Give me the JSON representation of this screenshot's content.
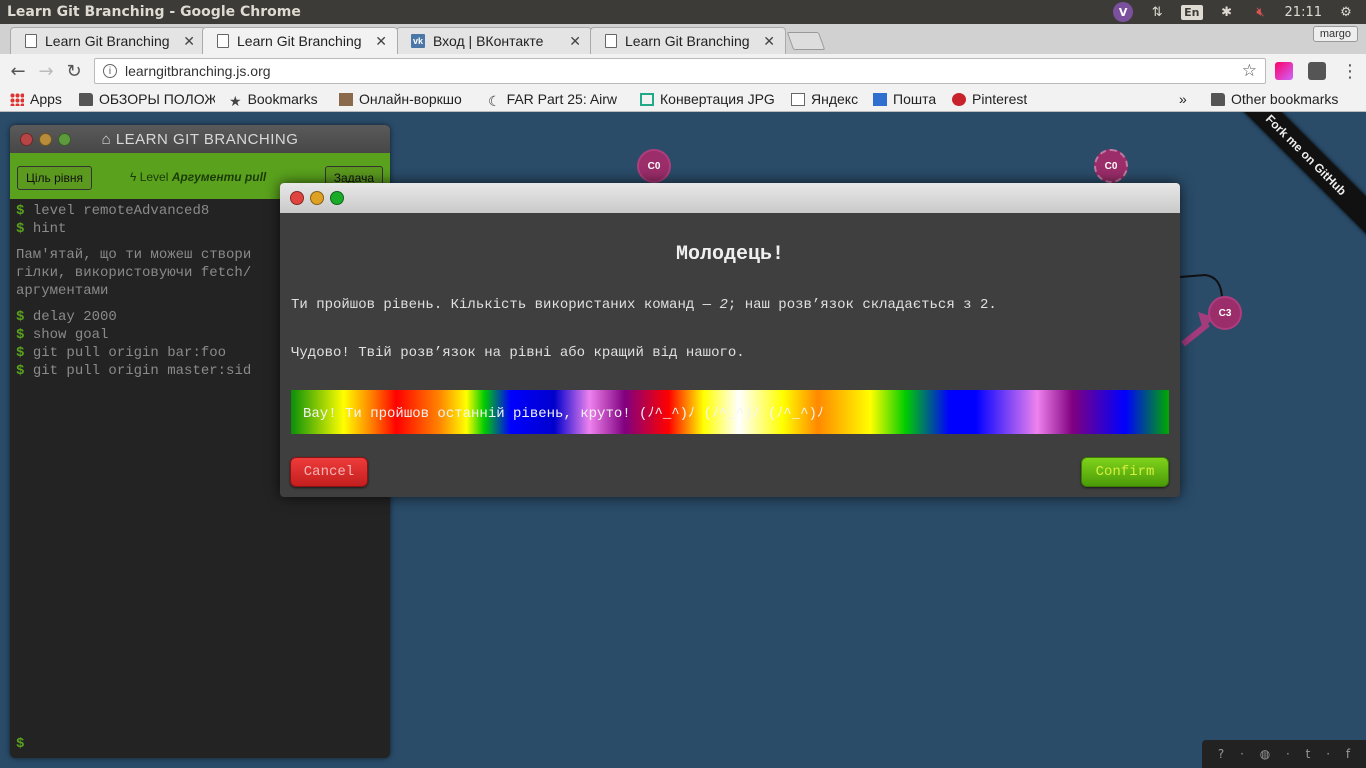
{
  "os_panel": {
    "window_title": "Learn Git Branching - Google Chrome",
    "keyboard_layout": "En",
    "clock": "21:11",
    "viber_letter": "V"
  },
  "tabs": [
    {
      "label": "Learn Git Branching",
      "active": false
    },
    {
      "label": "Learn Git Branching",
      "active": true
    },
    {
      "label": "Вход | ВКонтакте",
      "active": false
    },
    {
      "label": "Learn Git Branching",
      "active": false
    }
  ],
  "profile_name": "margo",
  "omnibox": {
    "url": "learngitbranching.js.org"
  },
  "bookmarks": [
    {
      "label": "Apps"
    },
    {
      "label": "ОБЗОРЫ ПОЛОЖ"
    },
    {
      "label": "Bookmarks"
    },
    {
      "label": "Онлайн-воркшо"
    },
    {
      "label": "FAR Part 25: Airw"
    },
    {
      "label": "Конвертация JPG"
    },
    {
      "label": "Яндекс"
    },
    {
      "label": "Пошта"
    },
    {
      "label": "Pinterest"
    }
  ],
  "bookmarks_overflow": "»",
  "other_bookmarks": "Other bookmarks",
  "terminal": {
    "title": "LEARN GIT BRANCHING",
    "level_goal_button": "Ціль рівня",
    "task_button": "Задача",
    "level_prefix": "Level",
    "level_name": "Аргументи pull",
    "lines_1": [
      "level remoteAdvanced8",
      "hint"
    ],
    "hint_text": "Пам'ятай, що ти можеш створи\nгілки, використовуючи fetch/\nаргументами",
    "lines_2": [
      "delay 2000",
      "show goal",
      "git pull origin bar:foo",
      "git pull origin master:sid"
    ],
    "prompt": "$"
  },
  "commits": [
    {
      "label": "C0"
    },
    {
      "label": "C0"
    },
    {
      "label": "C3"
    }
  ],
  "ribbon_text": "Fork me on GitHub",
  "footer_icons": [
    "help-icon",
    "globe-icon",
    "twitter-icon",
    "facebook-icon"
  ],
  "modal": {
    "title": "Молодець!",
    "line1_prefix": "Ти пройшов рівень. Кількість використаних команд — ",
    "line1_count": "2",
    "line1_middle": "; наш розв’язок складається з ",
    "line1_best": "2",
    "line1_suffix": ".",
    "line2": "Чудово! Твій розв’язок на рівні або кращий від нашого.",
    "rainbow_text": "Вау! Ти пройшов останній рівень, круто! (ﾉ^_^)ﾉ (ﾉ^_^)ﾉ (ﾉ^_^)ﾉ",
    "cancel_label": "Cancel",
    "confirm_label": "Confirm"
  }
}
